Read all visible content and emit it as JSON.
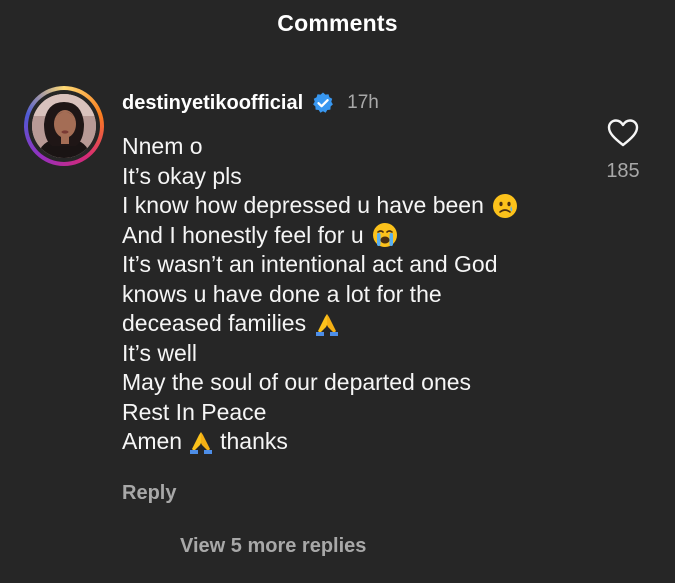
{
  "header": {
    "title": "Comments"
  },
  "comment": {
    "username": "destinyetikoofficial",
    "verified_icon": "verified-badge-icon",
    "timestamp": "17h",
    "lines": [
      "Nnem o",
      "It’s okay pls",
      "I know how depressed u have been",
      "And I honestly feel for u",
      "It’s wasn’t an intentional act and God",
      "knows u have done a lot for the",
      "deceased families",
      "It’s well",
      "May the soul of our departed ones",
      "Rest In Peace",
      "Amen",
      "thanks"
    ],
    "emojis": {
      "sad": "sad-tear-emoji",
      "crying": "loudly-crying-emoji",
      "pray": "folded-hands-emoji"
    },
    "like_icon": "heart-outline-icon",
    "like_count": "185",
    "reply_label": "Reply",
    "view_more_label": "View 5 more replies"
  },
  "colors": {
    "background": "#262626",
    "text_primary": "#f5f5f5",
    "text_secondary": "#a8a8a8",
    "verified_blue": "#3897f0"
  }
}
